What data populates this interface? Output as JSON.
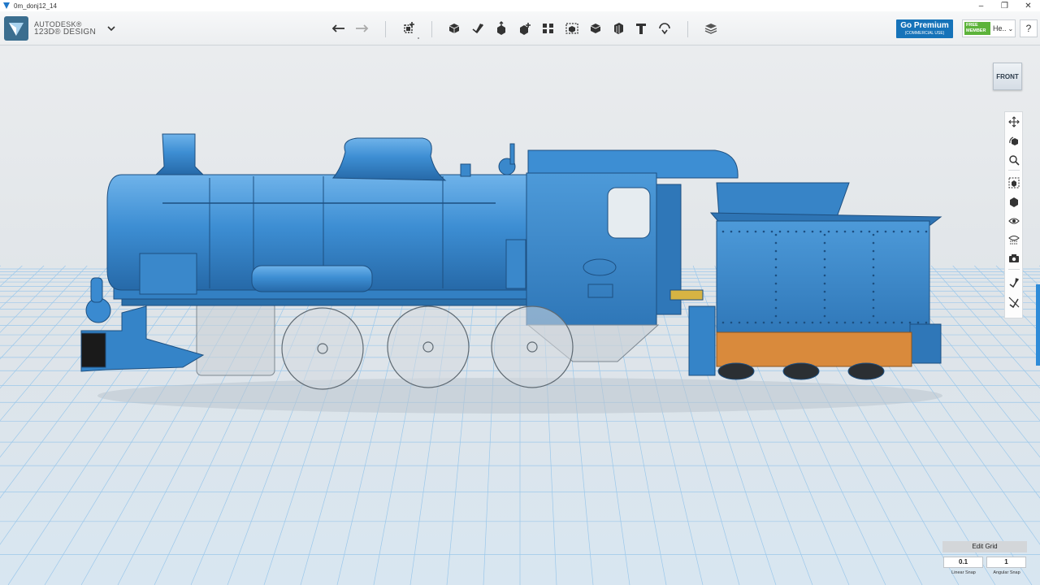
{
  "window": {
    "title": "0m_donj12_14",
    "controls": [
      "–",
      "❐",
      "✕"
    ]
  },
  "brand": {
    "line1": "AUTODESK®",
    "line2": "123D® DESIGN"
  },
  "toolbar": {
    "undo_icon": "undo-icon",
    "redo_icon": "redo-icon",
    "transform_icon": "transform-icon",
    "tools": [
      "primitives-icon",
      "sketch-icon",
      "construct-icon",
      "modify-icon",
      "pattern-icon",
      "group-icon",
      "combine-icon",
      "measure-icon",
      "text-icon",
      "snap-icon"
    ],
    "material_icon": "material-icon"
  },
  "premium": {
    "label": "Go Premium",
    "sublabel": "(COMMERCIAL USE)"
  },
  "user": {
    "badge_line1": "FREE",
    "badge_line2": "MEMBER",
    "name": "He..",
    "chevron": "⌄"
  },
  "help": {
    "label": "?"
  },
  "viewcube": {
    "face": "FRONT"
  },
  "navbar": {
    "icons": [
      "pan-icon",
      "orbit-icon",
      "zoom-icon",
      "fit-icon",
      "view-mode-icon",
      "visibility-icon",
      "materials-outline-icon",
      "screenshot-icon",
      "snap-icon",
      "hide-icon"
    ]
  },
  "grid": {
    "edit_label": "Edit Grid",
    "linear_snap_value": "0.1",
    "linear_snap_label": "Linear Snap",
    "angular_snap_value": "1",
    "angular_snap_label": "Angular Snap"
  },
  "colors": {
    "model_blue": "#3f8fd2",
    "model_orange": "#d98a3c",
    "grid_line": "#8fc0e6",
    "accent": "#1673b9",
    "badge_green": "#5cb33a"
  }
}
